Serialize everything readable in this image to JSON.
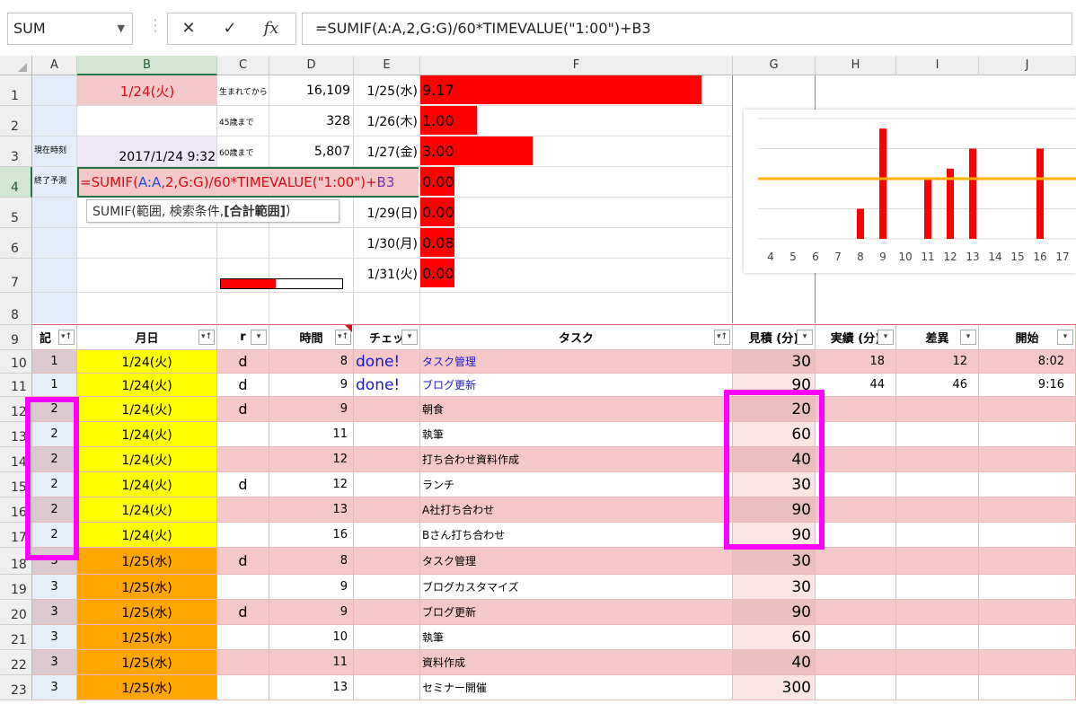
{
  "formula_bar": {
    "name_box": "SUM",
    "cancel_glyph": "✕",
    "enter_glyph": "✓",
    "fx_label": "fx",
    "formula": "=SUMIF(A:A,2,G:G)/60*TIMEVALUE(\"1:00\")+B3"
  },
  "columns": [
    "A",
    "B",
    "C",
    "D",
    "E",
    "F",
    "G",
    "H",
    "I",
    "J"
  ],
  "row_numbers": [
    "1",
    "2",
    "3",
    "4",
    "5",
    "6",
    "7",
    "8",
    "9",
    "10",
    "11",
    "12",
    "13",
    "14",
    "15",
    "16",
    "17",
    "18",
    "19",
    "20",
    "21",
    "22",
    "23"
  ],
  "top": {
    "b1": "1/24(火)",
    "a3": "現在時刻",
    "a4": "終了予測",
    "b3": "2017/1/24 9:32",
    "c_labels": [
      "生まれてから",
      "45歳まで",
      "60歳まで"
    ],
    "d_values": [
      "16,109",
      "328",
      "5,807"
    ],
    "e_dates": [
      "1/25(水)",
      "1/26(木)",
      "1/27(金)",
      "1/29(日)",
      "1/30(月)",
      "1/31(火)"
    ],
    "f_values": [
      "9.17",
      "1.00",
      "3.00",
      "0.00",
      "0.00",
      "0.08",
      "0.00"
    ],
    "f_fill": [
      1.0,
      0.2,
      0.4,
      0.12,
      0.12,
      0.12,
      0.12
    ],
    "progress_fill": 0.45,
    "edit_formula_parts": [
      {
        "t": "=SUMIF(",
        "c": "#d01018"
      },
      {
        "t": "A:A",
        "c": "#1f4fd8"
      },
      {
        "t": ",2,",
        "c": "#d01018"
      },
      {
        "t": "G:G",
        "c": "#d01018"
      },
      {
        "t": ")/60*TIMEVALUE(\"1:00\")+",
        "c": "#d01018"
      },
      {
        "t": "B3",
        "c": "#7a2fb8"
      }
    ],
    "tooltip_prefix": "SUMIF(範囲, 検索条件, ",
    "tooltip_bold": "[合計範囲]",
    "tooltip_suffix": ")"
  },
  "chart_data": {
    "type": "bar",
    "categories": [
      "4",
      "5",
      "6",
      "7",
      "8",
      "9",
      "10",
      "11",
      "12",
      "13",
      "14",
      "15",
      "16",
      "17"
    ],
    "values": [
      0,
      0,
      0,
      0,
      30,
      110,
      0,
      60,
      70,
      90,
      0,
      0,
      90,
      0
    ],
    "ylim": [
      0,
      120
    ],
    "reference_line": 60,
    "grid": true,
    "bar_color": "#ff0000",
    "line_color": "#ffb000"
  },
  "table": {
    "headers": [
      "記",
      "月日",
      "r",
      "時間",
      "チェッ",
      "タスク",
      "見積 (分)",
      "実績 (分)",
      "差異",
      "開始"
    ],
    "rows": [
      {
        "a": "1",
        "b": "1/24(火)",
        "c": "d",
        "d": "8",
        "e": "done!",
        "f": "タスク管理",
        "g": "30",
        "h": "18",
        "i": "12",
        "j": "8:02"
      },
      {
        "a": "1",
        "b": "1/24(火)",
        "c": "d",
        "d": "9",
        "e": "done!",
        "f": "ブログ更新",
        "g": "90",
        "h": "44",
        "i": "46",
        "j": "9:16"
      },
      {
        "a": "2",
        "b": "1/24(火)",
        "c": "d",
        "d": "9",
        "e": "",
        "f": "朝食",
        "g": "20",
        "h": "",
        "i": "",
        "j": ""
      },
      {
        "a": "2",
        "b": "1/24(火)",
        "c": "",
        "d": "11",
        "e": "",
        "f": "執筆",
        "g": "60",
        "h": "",
        "i": "",
        "j": ""
      },
      {
        "a": "2",
        "b": "1/24(火)",
        "c": "",
        "d": "12",
        "e": "",
        "f": "打ち合わせ資料作成",
        "g": "40",
        "h": "",
        "i": "",
        "j": ""
      },
      {
        "a": "2",
        "b": "1/24(火)",
        "c": "d",
        "d": "12",
        "e": "",
        "f": "ランチ",
        "g": "30",
        "h": "",
        "i": "",
        "j": ""
      },
      {
        "a": "2",
        "b": "1/24(火)",
        "c": "",
        "d": "13",
        "e": "",
        "f": "A社打ち合わせ",
        "g": "90",
        "h": "",
        "i": "",
        "j": ""
      },
      {
        "a": "2",
        "b": "1/24(火)",
        "c": "",
        "d": "16",
        "e": "",
        "f": "Bさん打ち合わせ",
        "g": "90",
        "h": "",
        "i": "",
        "j": ""
      },
      {
        "a": "3",
        "b": "1/25(水)",
        "c": "d",
        "d": "8",
        "e": "",
        "f": "タスク管理",
        "g": "30",
        "h": "",
        "i": "",
        "j": ""
      },
      {
        "a": "3",
        "b": "1/25(水)",
        "c": "",
        "d": "9",
        "e": "",
        "f": "ブログカスタマイズ",
        "g": "30",
        "h": "",
        "i": "",
        "j": ""
      },
      {
        "a": "3",
        "b": "1/25(水)",
        "c": "d",
        "d": "9",
        "e": "",
        "f": "ブログ更新",
        "g": "90",
        "h": "",
        "i": "",
        "j": ""
      },
      {
        "a": "3",
        "b": "1/25(水)",
        "c": "",
        "d": "10",
        "e": "",
        "f": "執筆",
        "g": "60",
        "h": "",
        "i": "",
        "j": ""
      },
      {
        "a": "3",
        "b": "1/25(水)",
        "c": "",
        "d": "11",
        "e": "",
        "f": "資料作成",
        "g": "40",
        "h": "",
        "i": "",
        "j": ""
      },
      {
        "a": "3",
        "b": "1/25(水)",
        "c": "",
        "d": "13",
        "e": "",
        "f": "セミナー開催",
        "g": "300",
        "h": "",
        "i": "",
        "j": ""
      }
    ]
  },
  "colors": {
    "pink": "#f4c7c9",
    "pink_light": "#fce4e4",
    "yellow": "#ffff00",
    "orange": "#ffa500",
    "lavender": "#ece6f5",
    "bar_red": "#ff0000",
    "magenta_highlight": "#ff00ff",
    "done_blue": "#1a1acc"
  }
}
